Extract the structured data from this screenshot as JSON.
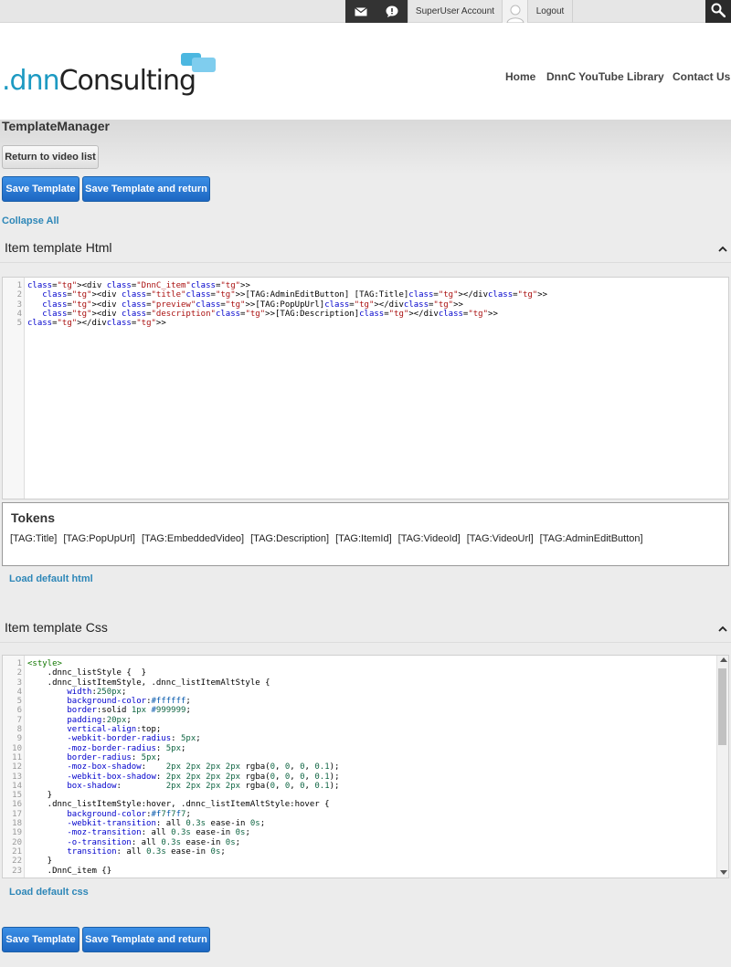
{
  "topbar": {
    "account_label": "SuperUser Account",
    "logout_label": "Logout"
  },
  "header": {
    "logo": {
      "prefix": ".dnn",
      "suffix": "Consulting"
    },
    "nav": [
      "Home",
      "DnnC YouTube Library",
      "Contact Us"
    ]
  },
  "page": {
    "title": "TemplateManager",
    "return_label": "Return to video list",
    "save_label": "Save Template",
    "save_return_label": "Save Template and return",
    "collapse_all_label": "Collapse All"
  },
  "html_section": {
    "title": "Item template Html",
    "code_lines": [
      "<div class=\"DnnC_item\">",
      "   <div class=\"title\">[TAG:AdminEditButton] [TAG:Title]</div>",
      "   <div class=\"preview\">[TAG:PopUpUrl]</div>",
      "   <div class=\"description\">[TAG:Description]</div>",
      "</div>"
    ],
    "load_default_label": "Load default html"
  },
  "tokens": {
    "title": "Tokens",
    "items": [
      "[TAG:Title]",
      "[TAG:PopUpUrl]",
      "[TAG:EmbeddedVideo]",
      "[TAG:Description]",
      "[TAG:ItemId]",
      "[TAG:VideoId]",
      "[TAG:VideoUrl]",
      "[TAG:AdminEditButton]"
    ]
  },
  "css_section": {
    "title": "Item template Css",
    "code_lines": [
      "<style>",
      "    .dnnc_listStyle {  }",
      "    .dnnc_listItemStyle, .dnnc_listItemAltStyle {",
      "        width:250px;",
      "        background-color:#ffffff;",
      "        border:solid 1px #999999;",
      "        padding:20px;",
      "        vertical-align:top;",
      "        -webkit-border-radius: 5px;",
      "        -moz-border-radius: 5px;",
      "        border-radius: 5px;",
      "        -moz-box-shadow:    2px 2px 2px 2px rgba(0, 0, 0, 0.1);",
      "        -webkit-box-shadow: 2px 2px 2px 2px rgba(0, 0, 0, 0.1);",
      "        box-shadow:         2px 2px 2px 2px rgba(0, 0, 0, 0.1);",
      "    }",
      "    .dnnc_listItemStyle:hover, .dnnc_listItemAltStyle:hover {",
      "        background-color:#f7f7f7;",
      "        -webkit-transition: all 0.3s ease-in 0s;",
      "        -moz-transition: all 0.3s ease-in 0s;",
      "        -o-transition: all 0.3s ease-in 0s;",
      "        transition: all 0.3s ease-in 0s;",
      "    }",
      "    .DnnC_item {}"
    ],
    "load_default_label": "Load default css"
  },
  "icons": {
    "mail": "mail-icon",
    "notifications": "notification-icon",
    "avatar": "user-avatar-icon",
    "search": "search-icon",
    "collapse": "chevron-up-icon"
  },
  "colors": {
    "brand_blue": "#4cb7e0",
    "link": "#2e87b8",
    "primary_button": "#1d67c2"
  }
}
